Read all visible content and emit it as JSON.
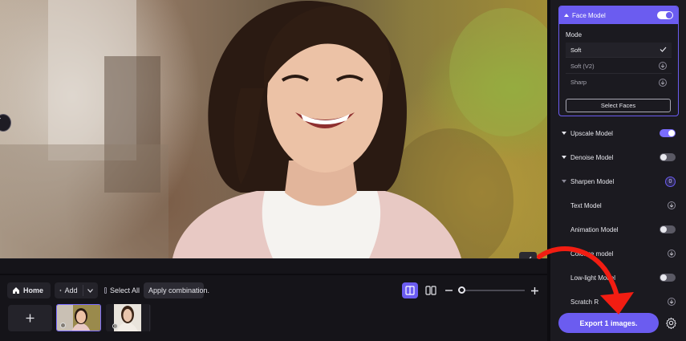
{
  "colors": {
    "accent": "#6b5cf0",
    "panel_bg": "#1b1a20",
    "toolbar_bg": "#151419",
    "annotation_arrow": "#f21d12"
  },
  "preview": {
    "image_subject": "smiling-woman-photo",
    "handle_icon": "chevron-right-icon",
    "check_icon": "check-icon"
  },
  "toolbar": {
    "home_label": "Home",
    "home_icon": "home-icon",
    "add_label": "Add",
    "add_icon": "plus-icon",
    "add_menu_icon": "chevron-down-icon",
    "select_all_label": "Select All",
    "apply_label": "Apply combination.",
    "view_single_icon": "single-view-icon",
    "view_split_icon": "split-view-icon",
    "zoom_minus_icon": "minus-icon",
    "zoom_plus_icon": "plus-icon"
  },
  "thumbnails": {
    "add_icon": "plus-icon",
    "items": [
      {
        "selected": true
      },
      {
        "selected": false
      }
    ]
  },
  "panel": {
    "face_model": {
      "label": "Face Model",
      "enabled": true,
      "mode_label": "Mode",
      "options": [
        {
          "label": "Soft",
          "state": "selected",
          "icon": "check-icon"
        },
        {
          "label": "Soft (V2)",
          "state": "download",
          "icon": "download-icon"
        },
        {
          "label": "Sharp",
          "state": "download",
          "icon": "download-icon"
        }
      ],
      "select_faces_label": "Select Faces"
    },
    "models": [
      {
        "label": "Upscale Model",
        "control": "toggle-on"
      },
      {
        "label": "Denoise Model",
        "control": "toggle-off"
      },
      {
        "label": "Sharpen Model",
        "control": "count",
        "count": "0"
      },
      {
        "label": "Text Model",
        "control": "download"
      },
      {
        "label": "Animation Model",
        "control": "toggle-off"
      },
      {
        "label": "Colorize model",
        "control": "download"
      },
      {
        "label": "Low-light Model",
        "control": "toggle-off"
      },
      {
        "label": "Scratch R",
        "control": "download"
      }
    ],
    "export_label": "Export 1 images.",
    "settings_icon": "gear-icon"
  }
}
